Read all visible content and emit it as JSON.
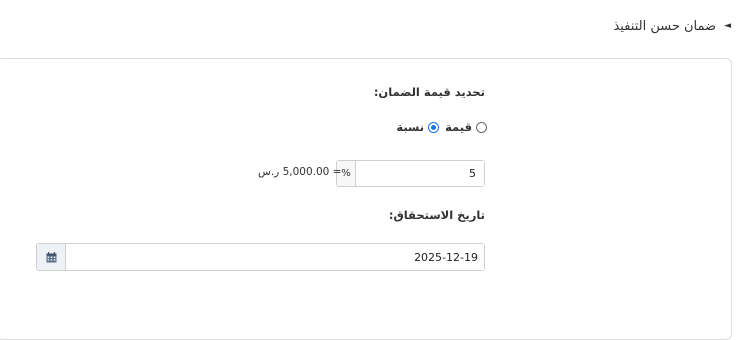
{
  "section": {
    "title": "ضمان حسن التنفيذ",
    "toggle_glyph": "◄"
  },
  "guarantee_value": {
    "label": "تحديد قيمة الضمان:",
    "options": [
      {
        "label": "قيمة",
        "checked": false
      },
      {
        "label": "نسبة",
        "checked": true
      }
    ],
    "percent_value": "5",
    "percent_symbol": "%",
    "computed_amount": "= 5,000.00 ر.س"
  },
  "due_date": {
    "label": "تاريخ الاستحقاق:",
    "value": "2025-12-19",
    "icon": "calendar-icon"
  },
  "colors": {
    "accent": "#1a73e8",
    "border": "#cfcfcf",
    "addon_bg": "#eef1f5"
  }
}
